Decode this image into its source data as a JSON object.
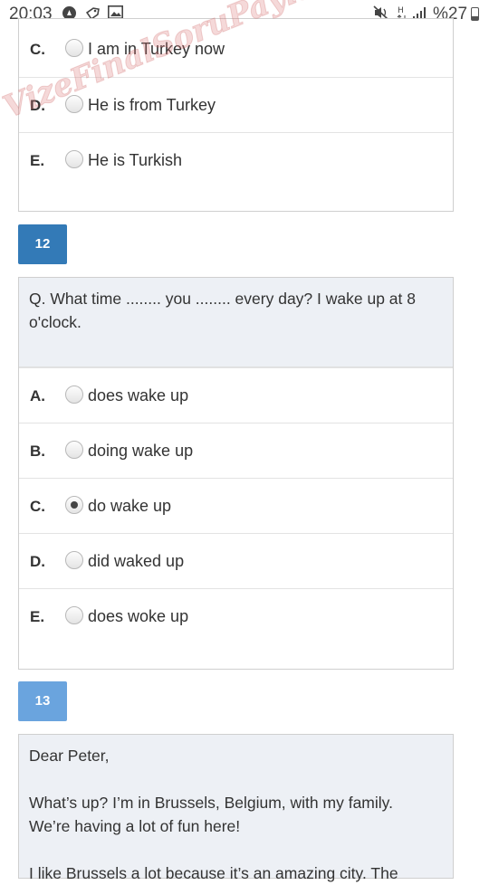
{
  "status_bar": {
    "time": "20:03",
    "battery": "%27",
    "icons": [
      "notification-icon",
      "tag-icon",
      "image-icon",
      "mute-icon",
      "vibrate-icon",
      "data-icon",
      "signal-icon",
      "battery-icon"
    ]
  },
  "q11": {
    "options": [
      {
        "letter": "C.",
        "text": "I am in Turkey now"
      },
      {
        "letter": "D.",
        "text": "He is from Turkey"
      },
      {
        "letter": "E.",
        "text": "He is Turkish"
      }
    ]
  },
  "watermark": "VizeFinalSoruPaylasimi.com",
  "q12": {
    "number": "12",
    "question": "Q. What  time ........ you ........ every day?  I wake up at 8 o'clock.",
    "options": [
      {
        "letter": "A.",
        "text": "does wake up"
      },
      {
        "letter": "B.",
        "text": "doing wake up"
      },
      {
        "letter": "C.",
        "text": "do wake up",
        "selected": true
      },
      {
        "letter": "D.",
        "text": "did waked up"
      },
      {
        "letter": "E.",
        "text": "does woke up"
      }
    ]
  },
  "q13": {
    "number": "13",
    "letter_lines": [
      "Dear Peter,",
      "What’s up? I’m in Brussels, Belgium, with my family.",
      "We’re having a lot of fun here!",
      "I like Brussels a lot because it’s an amazing city. The"
    ]
  },
  "colors": {
    "question_number_active": "#337ab7",
    "question_number_next": "#6aa4de",
    "question_bg": "#edf0f5"
  }
}
